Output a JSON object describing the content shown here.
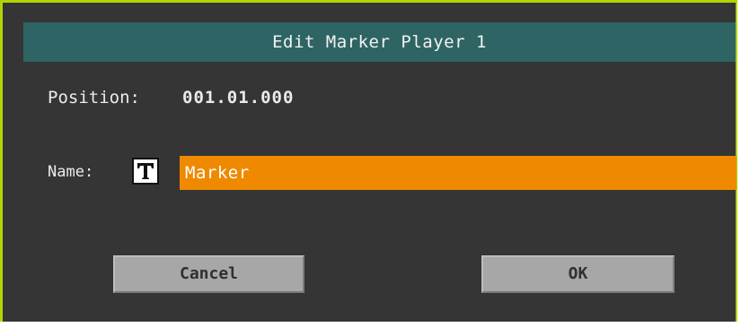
{
  "dialog": {
    "title": "Edit Marker Player 1",
    "position": {
      "label": "Position:",
      "value": "001.01.000"
    },
    "name": {
      "label": "Name:",
      "value": "Marker"
    },
    "buttons": {
      "cancel": "Cancel",
      "ok": "OK"
    }
  },
  "icons": {
    "text_edit": "text-edit-icon"
  },
  "colors": {
    "frame_border": "#b4d400",
    "background": "#353535",
    "title_bar": "#2e6464",
    "name_field": "#ef8a00",
    "button": "#a7a7a7"
  }
}
